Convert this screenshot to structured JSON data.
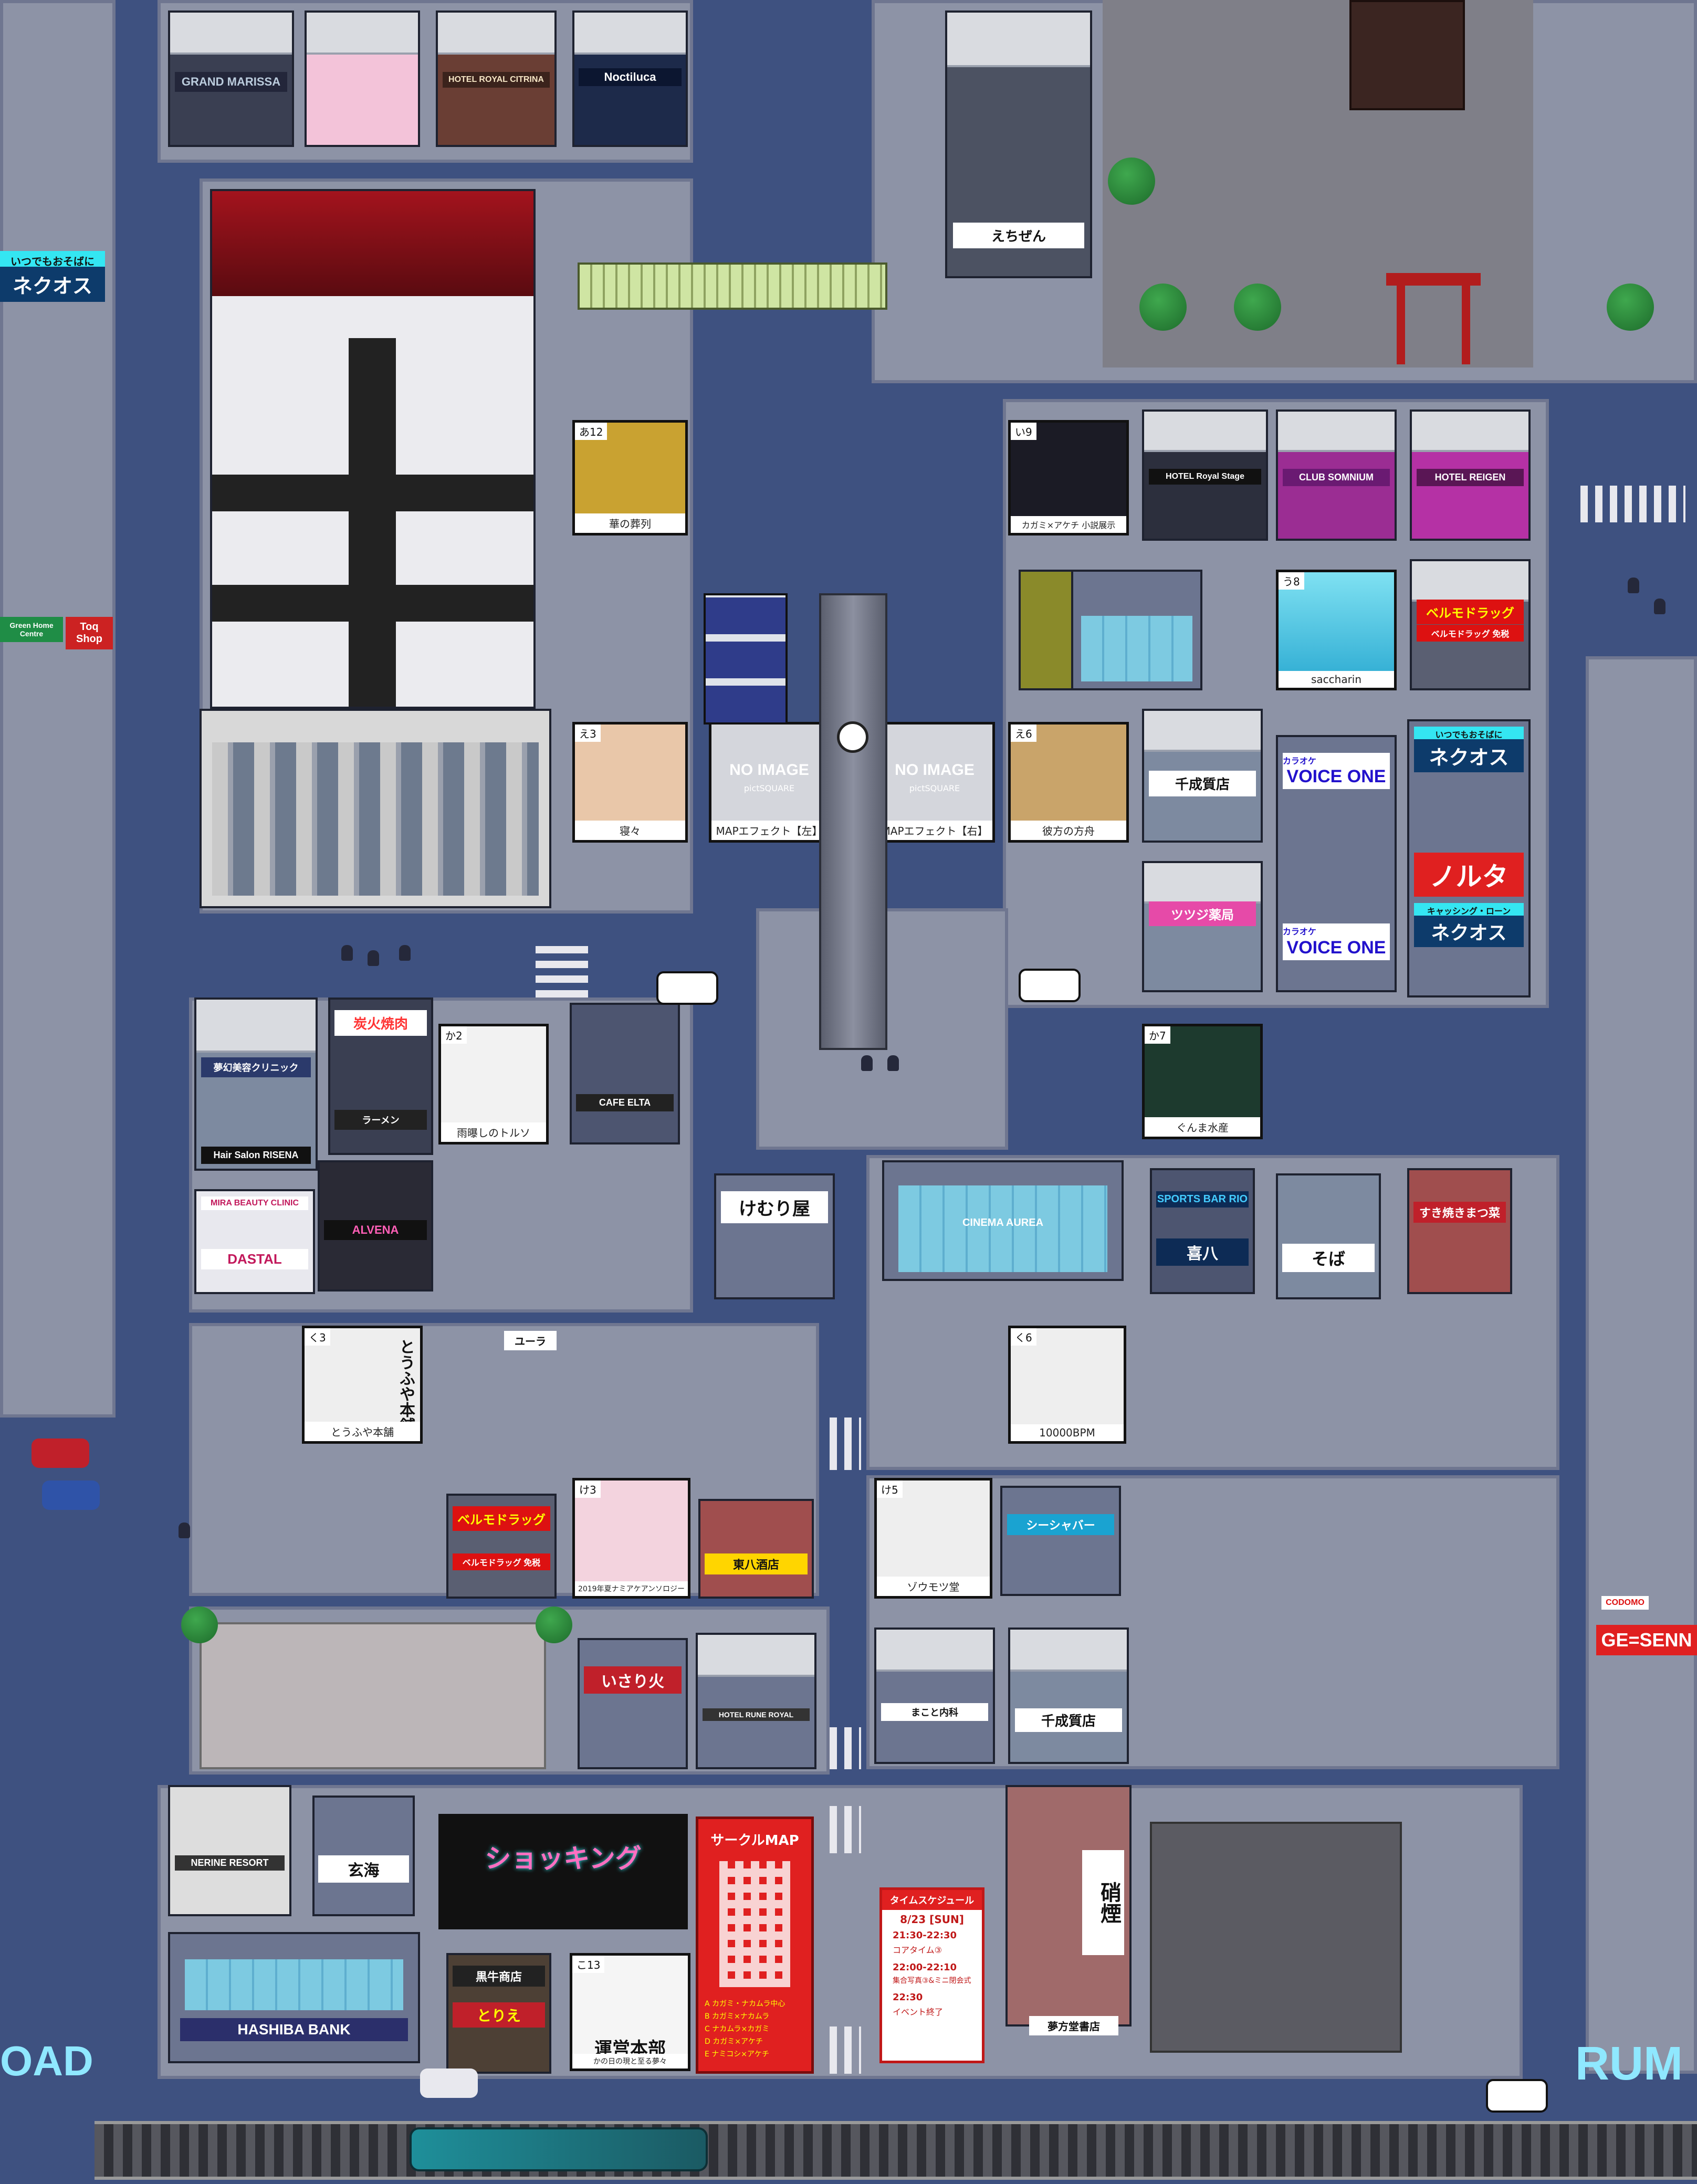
{
  "signs": {
    "grand_marissa": "GRAND MARISSA",
    "royal_citrina": "HOTEL ROYAL CITRINA",
    "noctiluca": "Noctiluca",
    "nekuosu_left_top": "いつでもおそばに",
    "nekuosu_left": "ネクオス",
    "green_home": "Green Home Centre",
    "toq_shop": "Toq Shop",
    "shrine_sign": "えちぜん",
    "royal_stage": "HOTEL Royal Stage",
    "club_somnium": "CLUB SOMNIUM",
    "hotel_reigen": "HOTEL REIGEN",
    "berumo_1": "ベルモドラッグ",
    "berumo_1_sub": "ベルモドラッグ 免税",
    "senari": "千成質店",
    "voice_one_1": "VOICE ONE",
    "voice_one_2": "VOICE ONE",
    "karaoke_1": "カラオケ",
    "karaoke_2": "カラオケ",
    "nekuosu_right_top": "いつでもおそばに",
    "nekuosu_right": "ネクオス",
    "noruta": "ノルタ",
    "nekuosu_loan_top": "キャッシング・ローン",
    "nekuosu_loan": "ネクオス",
    "tsutsuji": "ツツジ薬局",
    "no_image_1": "NO IMAGE",
    "no_image_2": "NO IMAGE",
    "pictsquare": "pictSQUARE",
    "map_effect_l": "MAPエフェクト【左】",
    "map_effect_r": "MAPエフェクト【右】",
    "yakiniku": "炭火焼肉",
    "yumemaboroshi": "夢幻美容クリニック",
    "ramen": "ラーメン",
    "risena": "Hair Salon RISENA",
    "mira": "MIRA BEAUTY CLINIC",
    "dastal": "DASTAL",
    "alvena": "ALVENA",
    "cafe_elta": "CAFE ELTA",
    "kemuriya": "けむり屋",
    "cinema_aurea": "CINEMA AUREA",
    "sports_bar": "SPORTS BAR RIO",
    "kiyahachi": "喜八",
    "soba": "そば",
    "sukiyaki": "すき焼きまつ菜",
    "yura": "ユーラ",
    "tofuya": "とうふや本舗",
    "berumo_2": "ベルモドラッグ",
    "berumo_2_sub": "ベルモドラッグ 免税",
    "tohachi": "東八酒店",
    "shiyabaa": "シーシャバー",
    "izakaya": "いさり火",
    "senari_2": "千成質店",
    "makoto": "まこと内科",
    "rune_royal": "HOTEL RUNE ROYAL",
    "nerine": "NERINE RESORT",
    "genkai": "玄海",
    "hashiba_bank": "HASHIBA BANK",
    "kuroushi": "黒牛商店",
    "torie": "とりえ",
    "shopping": "ショッキング",
    "circle_map": "サークルMAP",
    "circle_list": [
      "A カガミ・ナカムラ中心",
      "B カガミ×ナカムラ",
      "C ナカムラ×カガミ",
      "D カガミ×アケチ",
      "E ナミコシ×アケチ"
    ],
    "schedule_title": "タイムスケジュール",
    "schedule_date": "8/23 [SUN]",
    "schedule": [
      {
        "time": "21:30-22:30",
        "label": "コアタイム③"
      },
      {
        "time": "22:00-22:10",
        "label": "集合写真③&ミニ閉会式"
      },
      {
        "time": "22:30",
        "label": "イベント終了"
      }
    ],
    "hakuen": "硝煙",
    "yumekata": "夢方堂書店",
    "hq": "運営本部",
    "codomo": "CODOMO",
    "ge_senn": "GE=SENN",
    "road_left": "OAD",
    "road_right": "RUM"
  },
  "posters": [
    {
      "tag": "あ12",
      "caption": "華の葬列"
    },
    {
      "tag": "え3",
      "caption": "寝々"
    },
    {
      "tag": "え6",
      "caption": "彼方の方舟"
    },
    {
      "tag": "い9",
      "caption": "カガミ×アケチ 小説展示"
    },
    {
      "tag": "う8",
      "caption": "saccharin"
    },
    {
      "tag": "か2",
      "caption": "雨曝しのトルソ"
    },
    {
      "tag": "か7",
      "caption": "ぐんま水産"
    },
    {
      "tag": "く3",
      "caption": "とうふや本舗"
    },
    {
      "tag": "く6",
      "caption": "10000BPM"
    },
    {
      "tag": "け3",
      "caption": "2019年夏ナミアケアンソロジー"
    },
    {
      "tag": "け5",
      "caption": "ゾウモツ堂"
    },
    {
      "tag": "こ13",
      "caption": "かの日の現と至る夢々"
    }
  ],
  "colors": {
    "road": "#3e5180",
    "sidewalk": "#8d93a6",
    "glass": "#7fd3ea",
    "neon_pink": "#ff3fa4",
    "neon_cyan": "#34e6f2",
    "red_sign": "#e02020"
  }
}
